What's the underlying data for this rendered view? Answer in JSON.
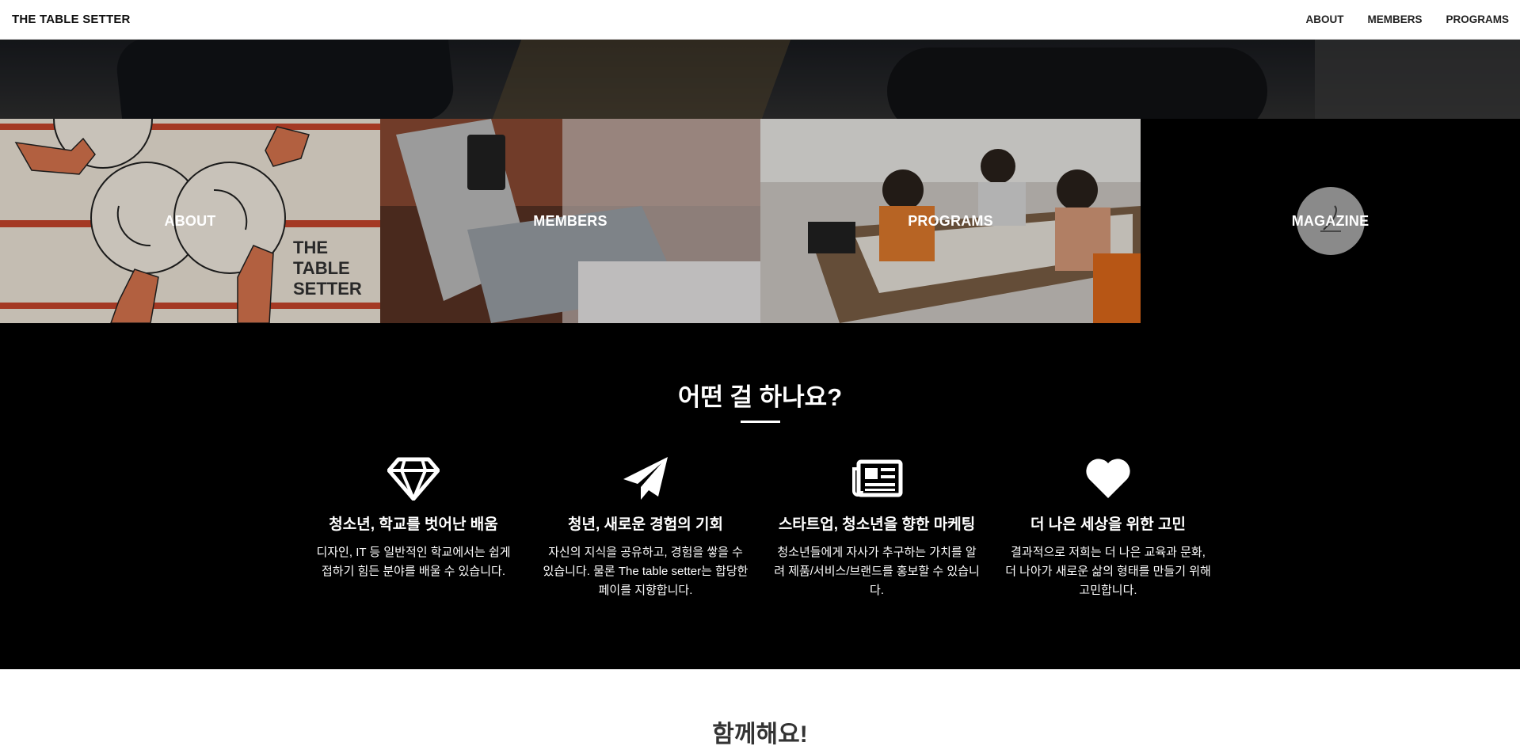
{
  "nav": {
    "brand": "THE TABLE SETTER",
    "links": [
      "ABOUT",
      "MEMBERS",
      "PROGRAMS"
    ]
  },
  "tiles": [
    {
      "label": "ABOUT",
      "image_text": "THE TABLE SETTER"
    },
    {
      "label": "MEMBERS"
    },
    {
      "label": "PROGRAMS"
    },
    {
      "label": "MAGAZINE"
    }
  ],
  "services": {
    "title": "어떤 걸 하나요?",
    "features": [
      {
        "icon": "diamond-icon",
        "title": "청소년, 학교를 벗어난 배움",
        "text": "디자인, IT 등 일반적인 학교에서는 쉽게 접하기 힘든 분야를 배울 수 있습니다."
      },
      {
        "icon": "paper-plane-icon",
        "title": "청년, 새로운 경험의 기회",
        "text": "자신의 지식을 공유하고, 경험을 쌓을 수 있습니다. 물론 The table setter는 합당한 페이를 지향합니다."
      },
      {
        "icon": "newspaper-icon",
        "title": "스타트업, 청소년을 향한 마케팅",
        "text": "청소년들에게 자사가 추구하는 가치를 알려 제품/서비스/브랜드를 홍보할 수 있습니다."
      },
      {
        "icon": "heart-icon",
        "title": "더 나은 세상을 위한 고민",
        "text": "결과적으로 저희는 더 나은 교육과 문화, 더 나아가 새로운 삶의 형태를 만들기 위해 고민합니다."
      }
    ]
  },
  "together": {
    "title": "함께해요!"
  },
  "colors": {
    "nav_bg": "#ffffff",
    "section_bg": "#000000",
    "text_light": "#ffffff",
    "text_dark": "#333333"
  }
}
